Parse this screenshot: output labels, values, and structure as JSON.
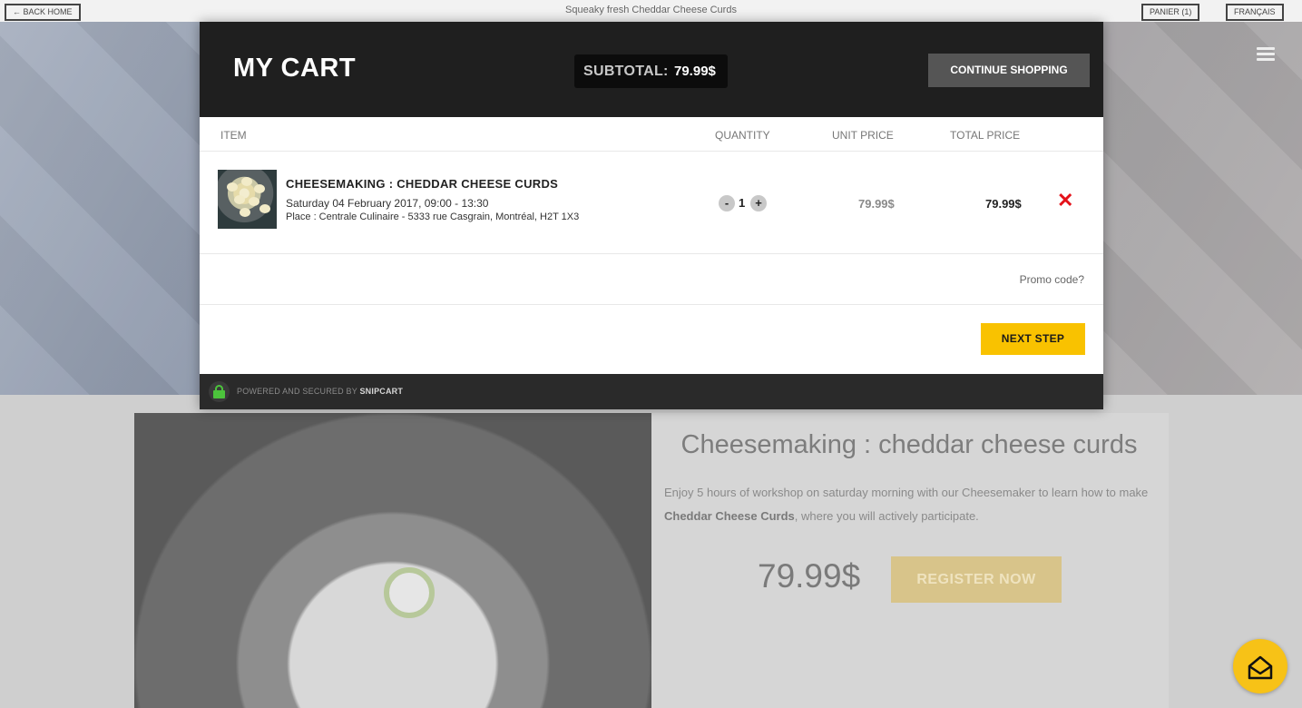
{
  "topbar": {
    "back_label": "← BACK HOME",
    "title": "Squeaky fresh Cheddar Cheese Curds",
    "cart_label": "PANIER (1)",
    "lang_label": "FRANÇAIS"
  },
  "product": {
    "title": "Cheesemaking : cheddar cheese curds",
    "desc_start": "Enjoy 5 hours of workshop on saturday morning with our Cheesemaker to learn how to make ",
    "desc_bold": "Cheddar Cheese Curds",
    "desc_end": ", where you will actively participate.",
    "price": "79.99$",
    "register_label": "REGISTER NOW"
  },
  "cart": {
    "title": "MY CART",
    "subtotal_label": "SUBTOTAL:",
    "subtotal_value": "79.99$",
    "continue_label": "CONTINUE SHOPPING",
    "columns": {
      "item": "ITEM",
      "quantity": "QUANTITY",
      "unit_price": "UNIT PRICE",
      "total_price": "TOTAL PRICE"
    },
    "items": [
      {
        "name": "CHEESEMAKING : CHEDDAR CHEESE CURDS",
        "date": "Saturday 04 February 2017, 09:00 - 13:30",
        "place": "Place : Centrale Culinaire - 5333 rue Casgrain, Montréal, H2T 1X3",
        "quantity": "1",
        "unit_price": "79.99$",
        "total_price": "79.99$",
        "minus": "-",
        "plus": "+",
        "remove": "✕"
      }
    ],
    "promo_label": "Promo code?",
    "next_label": "NEXT STEP",
    "footer_prefix": "POWERED AND SECURED BY ",
    "footer_brand": "SNIPCART"
  },
  "colors": {
    "accent": "#f9c200",
    "modal_header": "#1f1f1f",
    "remove": "#e4121a"
  },
  "icons": [
    "hamburger-menu-icon",
    "cart-icon",
    "lock-icon",
    "close-icon",
    "chat-icon"
  ]
}
